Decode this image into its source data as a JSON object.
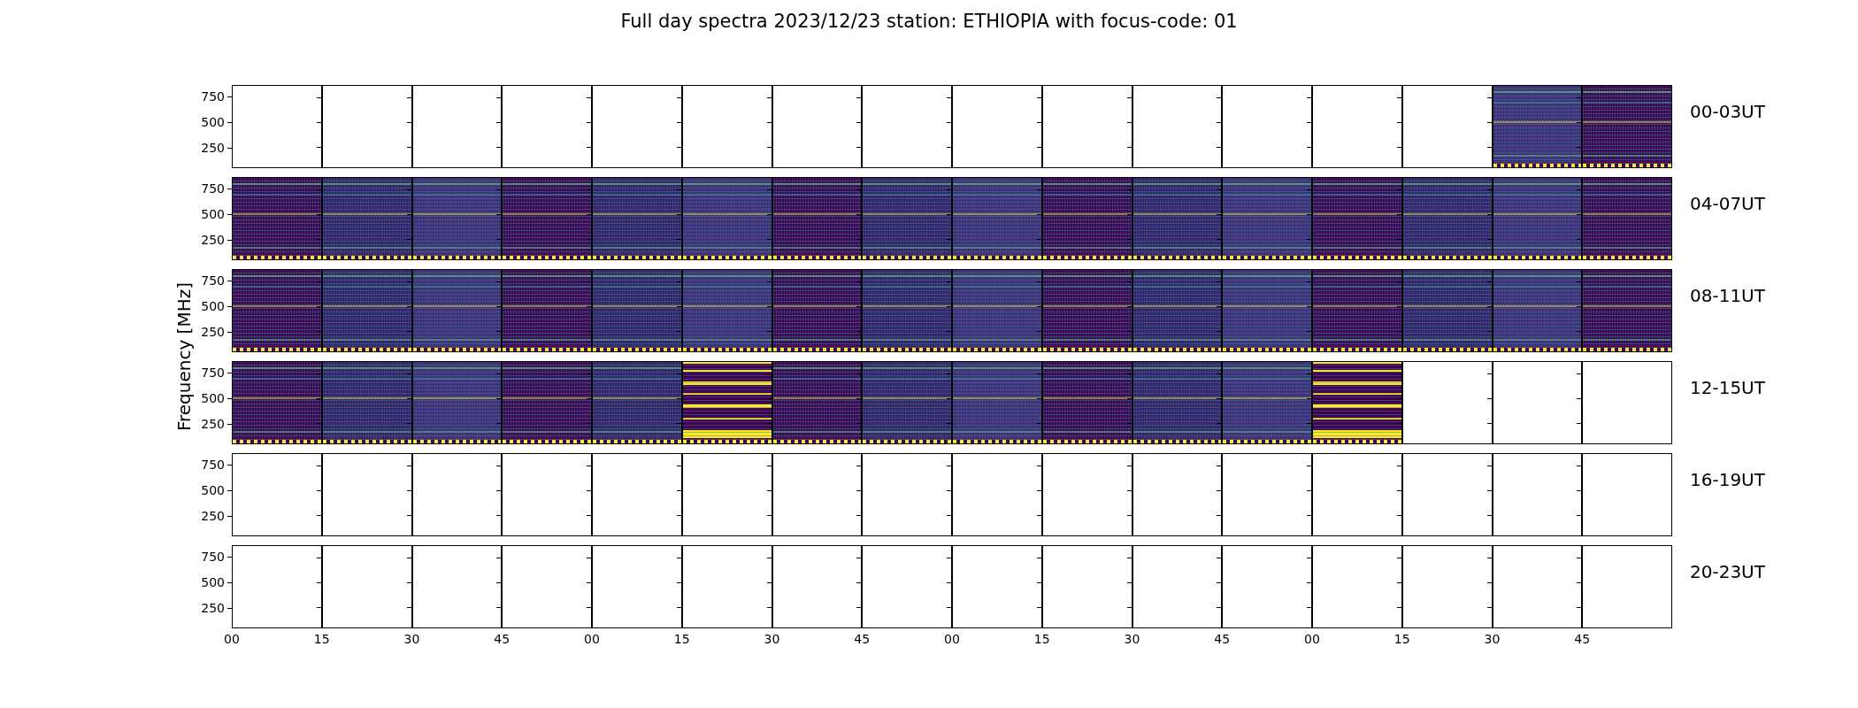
{
  "title": "Full day spectra 2023/12/23 station: ETHIOPIA with focus-code: 01",
  "ylabel": "Frequency [MHz]",
  "rows": [
    {
      "label": "00-03UT",
      "yticks": [
        "750",
        "500",
        "250"
      ],
      "panels": [
        {
          "kind": "blank"
        },
        {
          "kind": "blank"
        },
        {
          "kind": "blank"
        },
        {
          "kind": "blank"
        },
        {
          "kind": "blank"
        },
        {
          "kind": "blank"
        },
        {
          "kind": "blank"
        },
        {
          "kind": "blank"
        },
        {
          "kind": "blank"
        },
        {
          "kind": "blank"
        },
        {
          "kind": "blank"
        },
        {
          "kind": "blank"
        },
        {
          "kind": "blank"
        },
        {
          "kind": "blank"
        },
        {
          "kind": "spectrum"
        },
        {
          "kind": "spectrum"
        }
      ]
    },
    {
      "label": "04-07UT",
      "yticks": [
        "750",
        "500",
        "250"
      ],
      "panels": [
        {
          "kind": "spectrum"
        },
        {
          "kind": "spectrum"
        },
        {
          "kind": "spectrum"
        },
        {
          "kind": "spectrum"
        },
        {
          "kind": "spectrum"
        },
        {
          "kind": "spectrum"
        },
        {
          "kind": "spectrum"
        },
        {
          "kind": "spectrum"
        },
        {
          "kind": "spectrum"
        },
        {
          "kind": "spectrum"
        },
        {
          "kind": "spectrum"
        },
        {
          "kind": "spectrum"
        },
        {
          "kind": "spectrum"
        },
        {
          "kind": "spectrum"
        },
        {
          "kind": "spectrum"
        },
        {
          "kind": "spectrum"
        }
      ]
    },
    {
      "label": "08-11UT",
      "yticks": [
        "750",
        "500",
        "250"
      ],
      "panels": [
        {
          "kind": "spectrum"
        },
        {
          "kind": "spectrum"
        },
        {
          "kind": "spectrum"
        },
        {
          "kind": "spectrum"
        },
        {
          "kind": "spectrum"
        },
        {
          "kind": "spectrum"
        },
        {
          "kind": "spectrum"
        },
        {
          "kind": "spectrum"
        },
        {
          "kind": "spectrum"
        },
        {
          "kind": "spectrum"
        },
        {
          "kind": "spectrum"
        },
        {
          "kind": "spectrum"
        },
        {
          "kind": "spectrum"
        },
        {
          "kind": "spectrum"
        },
        {
          "kind": "spectrum"
        },
        {
          "kind": "spectrum"
        }
      ]
    },
    {
      "label": "12-15UT",
      "yticks": [
        "750",
        "500",
        "250"
      ],
      "panels": [
        {
          "kind": "spectrum"
        },
        {
          "kind": "spectrum"
        },
        {
          "kind": "spectrum"
        },
        {
          "kind": "spectrum"
        },
        {
          "kind": "spectrum"
        },
        {
          "kind": "bright"
        },
        {
          "kind": "spectrum"
        },
        {
          "kind": "spectrum"
        },
        {
          "kind": "spectrum"
        },
        {
          "kind": "spectrum"
        },
        {
          "kind": "spectrum"
        },
        {
          "kind": "spectrum"
        },
        {
          "kind": "bright"
        },
        {
          "kind": "blank"
        },
        {
          "kind": "blank"
        },
        {
          "kind": "blank"
        }
      ]
    },
    {
      "label": "16-19UT",
      "yticks": [
        "750",
        "500",
        "250"
      ],
      "panels": [
        {
          "kind": "blank"
        },
        {
          "kind": "blank"
        },
        {
          "kind": "blank"
        },
        {
          "kind": "blank"
        },
        {
          "kind": "blank"
        },
        {
          "kind": "blank"
        },
        {
          "kind": "blank"
        },
        {
          "kind": "blank"
        },
        {
          "kind": "blank"
        },
        {
          "kind": "blank"
        },
        {
          "kind": "blank"
        },
        {
          "kind": "blank"
        },
        {
          "kind": "blank"
        },
        {
          "kind": "blank"
        },
        {
          "kind": "blank"
        },
        {
          "kind": "blank"
        }
      ]
    },
    {
      "label": "20-23UT",
      "yticks": [
        "750",
        "500",
        "250"
      ],
      "panels": [
        {
          "kind": "blank"
        },
        {
          "kind": "blank"
        },
        {
          "kind": "blank"
        },
        {
          "kind": "blank"
        },
        {
          "kind": "blank"
        },
        {
          "kind": "blank"
        },
        {
          "kind": "blank"
        },
        {
          "kind": "blank"
        },
        {
          "kind": "blank"
        },
        {
          "kind": "blank"
        },
        {
          "kind": "blank"
        },
        {
          "kind": "blank"
        },
        {
          "kind": "blank"
        },
        {
          "kind": "blank"
        },
        {
          "kind": "blank"
        },
        {
          "kind": "blank"
        }
      ]
    }
  ],
  "xticks": [
    "00",
    "15",
    "30",
    "45",
    "00",
    "15",
    "30",
    "45",
    "00",
    "15",
    "30",
    "45",
    "00",
    "15",
    "30",
    "45"
  ]
}
